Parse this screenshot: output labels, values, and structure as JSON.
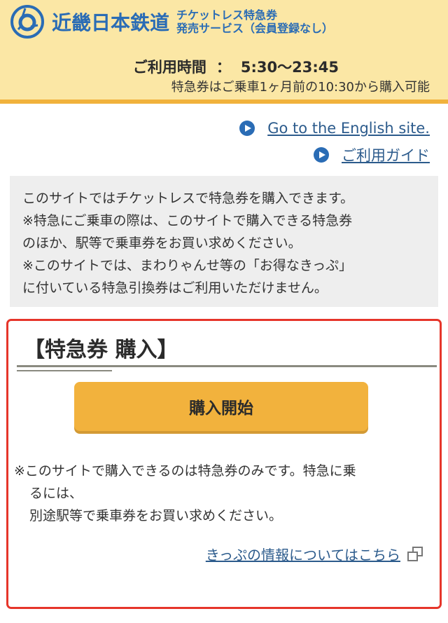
{
  "header": {
    "brand": "近畿日本鉄道",
    "service_line1": "チケットレス特急券",
    "service_line2": "発売サービス（会員登録なし）",
    "hours_label": "ご利用時間",
    "hours_sep": "：",
    "hours_value": "5:30〜23:45",
    "note": "特急券はご乗車1ヶ月前の10:30から購入可能"
  },
  "links": {
    "english": "Go to the English site.",
    "guide": "ご利用ガイド"
  },
  "info": {
    "lines": [
      "このサイトではチケットレスで特急券を購入できます。",
      "※特急にご乗車の際は、このサイトで購入できる特急券",
      "のほか、駅等で乗車券をお買い求めください。",
      "※このサイトでは、まわりゃんせ等の「お得なきっぷ」",
      "に付いている特急引換券はご利用いただけません。"
    ]
  },
  "purchase": {
    "title": "【特急券 購入】",
    "start_button": "購入開始",
    "notice_lines": [
      "※このサイトで購入できるのは特急券のみです。特急に乗",
      "るには、",
      "別途駅等で乗車券をお買い求めください。"
    ],
    "ticket_info_link": "きっぷの情報についてはこちら"
  },
  "colors": {
    "header_bg": "#fbe7a5",
    "header_accent": "#f1b23c",
    "brand_blue": "#2a6cb5",
    "button": "#f2b23d",
    "frame_red": "#e6352a"
  }
}
